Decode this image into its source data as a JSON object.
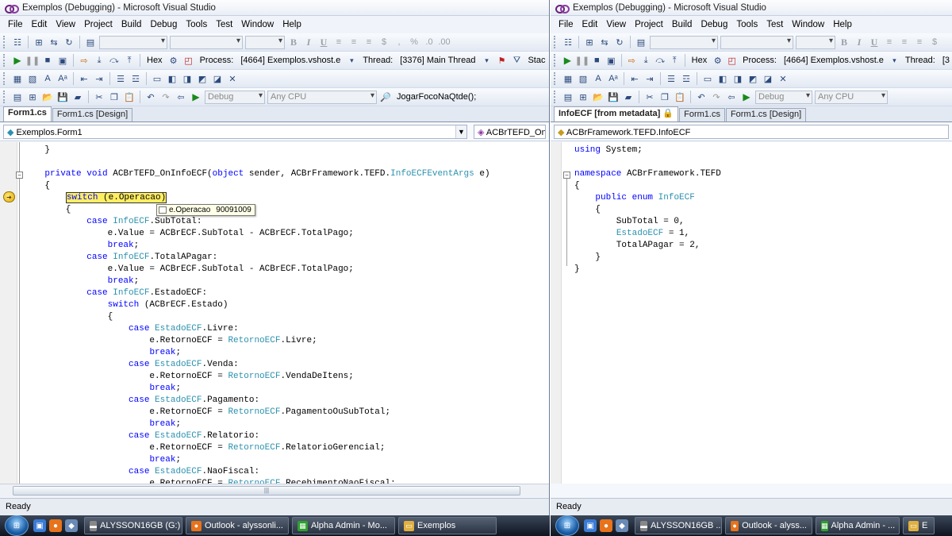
{
  "left": {
    "title": "Exemplos (Debugging) - Microsoft Visual Studio",
    "menu": [
      "File",
      "Edit",
      "View",
      "Project",
      "Build",
      "Debug",
      "Tools",
      "Test",
      "Window",
      "Help"
    ],
    "debug_toolbar": {
      "hex_label": "Hex",
      "process_label": "Process:",
      "process_value": "[4664] Exemplos.vshost.e",
      "thread_label": "Thread:",
      "thread_value": "[3376] Main Thread",
      "stack_label": "Stac"
    },
    "std_toolbar": {
      "config": "Debug",
      "platform": "Any CPU",
      "find_text": "JogarFocoNaQtde();"
    },
    "tabs": [
      "Form1.cs",
      "Form1.cs [Design]"
    ],
    "nav": {
      "type_combo": "Exemplos.Form1",
      "member_combo": "ACBrTEFD_OnIr"
    },
    "code_lines": [
      "    }",
      "",
      "    private void ACBrTEFD_OnInfoECF(object sender, ACBrFramework.TEFD.InfoECFEventArgs e)",
      "    {",
      "        switch (e.Operacao)",
      "        {",
      "            case InfoECF.SubTotal:",
      "                e.Value = ACBrECF.SubTotal - ACBrECF.TotalPago;",
      "                break;",
      "            case InfoECF.TotalAPagar:",
      "                e.Value = ACBrECF.SubTotal - ACBrECF.TotalPago;",
      "                break;",
      "            case InfoECF.EstadoECF:",
      "                switch (ACBrECF.Estado)",
      "                {",
      "                    case EstadoECF.Livre:",
      "                        e.RetornoECF = RetornoECF.Livre;",
      "                        break;",
      "                    case EstadoECF.Venda:",
      "                        e.RetornoECF = RetornoECF.VendaDeItens;",
      "                        break;",
      "                    case EstadoECF.Pagamento:",
      "                        e.RetornoECF = RetornoECF.PagamentoOuSubTotal;",
      "                        break;",
      "                    case EstadoECF.Relatorio:",
      "                        e.RetornoECF = RetornoECF.RelatorioGerencial;",
      "                        break;",
      "                    case EstadoECF.NaoFiscal:",
      "                        e.RetornoECF = RetornoECF.RecebimentoNaoFiscal;"
    ],
    "tooltip": {
      "name": "e.Operacao",
      "value": "90091009"
    },
    "status": "Ready"
  },
  "right": {
    "title": "Exemplos (Debugging) - Microsoft Visual Studio",
    "menu": [
      "File",
      "Edit",
      "View",
      "Project",
      "Build",
      "Debug",
      "Tools",
      "Test",
      "Window",
      "Help"
    ],
    "debug_toolbar": {
      "hex_label": "Hex",
      "process_label": "Process:",
      "process_value": "[4664] Exemplos.vshost.e",
      "thread_label": "Thread:",
      "thread_value": "[3"
    },
    "std_toolbar": {
      "config": "Debug",
      "platform": "Any CPU"
    },
    "tabs": [
      "InfoECF [from metadata]",
      "Form1.cs",
      "Form1.cs [Design]"
    ],
    "nav": {
      "type_combo": "ACBrFramework.TEFD.InfoECF"
    },
    "code_lines": [
      "using System;",
      "",
      "namespace ACBrFramework.TEFD",
      "{",
      "    public enum InfoECF",
      "    {",
      "        SubTotal = 0,",
      "        EstadoECF = 1,",
      "        TotalAPagar = 2,",
      "    }",
      "}"
    ],
    "status": "Ready"
  },
  "taskbar_left": [
    "ALYSSON16GB (G:)",
    "Outlook - alyssonli...",
    "Alpha Admin - Mo...",
    "Exemplos"
  ],
  "taskbar_right": [
    "ALYSSON16GB ...",
    "Outlook - alyss...",
    "Alpha Admin - ...",
    "E"
  ],
  "colors": {
    "keyword": "#0000ff",
    "type": "#2b91af",
    "current_statement": "#ffee62",
    "taskbar": "#1f2836"
  }
}
